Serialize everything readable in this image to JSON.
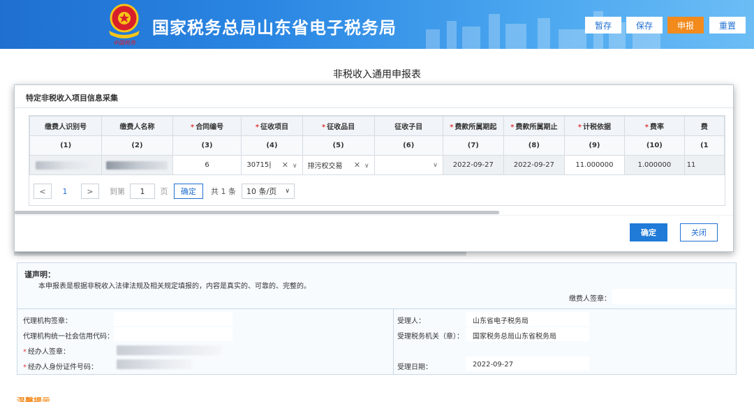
{
  "header": {
    "title": "国家税务总局山东省电子税务局",
    "emblem_caption": "中国税务",
    "buttons": [
      "暂存",
      "保存",
      "申报",
      "重置"
    ],
    "accent_color": "#f28a1c",
    "brand_color": "#1f6fd1"
  },
  "form_title": "非税收入通用申报表",
  "modal": {
    "title": "特定非税收入项目信息采集",
    "columns": [
      {
        "label": "缴费人识别号",
        "required": false,
        "index": "(1)"
      },
      {
        "label": "缴费人名称",
        "required": false,
        "index": "(2)"
      },
      {
        "label": "合同编号",
        "required": true,
        "index": "(3)"
      },
      {
        "label": "征收项目",
        "required": true,
        "index": "(4)"
      },
      {
        "label": "征收品目",
        "required": true,
        "index": "(5)"
      },
      {
        "label": "征收子目",
        "required": false,
        "index": "(6)"
      },
      {
        "label": "费款所属期起",
        "required": true,
        "index": "(7)"
      },
      {
        "label": "费款所属期止",
        "required": true,
        "index": "(8)"
      },
      {
        "label": "计税依据",
        "required": true,
        "index": "(9)"
      },
      {
        "label": "费率",
        "required": true,
        "index": "(10)"
      },
      {
        "label": "费",
        "required": false,
        "index": "(1"
      }
    ],
    "row": {
      "contract_no": "6",
      "levy_item": "30715|",
      "levy_category": "排污权交易",
      "levy_sub": "",
      "period_start": "2022-09-27",
      "period_end": "2022-09-27",
      "tax_basis": "11.000000",
      "rate": "1.000000",
      "fee_partial": "11"
    },
    "pager": {
      "prev": "<",
      "current": "1",
      "next": ">",
      "goto_label": "到第",
      "goto_value": "1",
      "page_unit": "页",
      "confirm": "确定",
      "total": "共 1 条",
      "page_size": "10 条/页"
    },
    "confirm_button": "确定",
    "close_button": "关闭"
  },
  "declaration": {
    "heading": "谨声明：",
    "text": "本申报表是根据非税收入法律法规及相关规定填报的，内容是真实的、可靠的、完整的。",
    "payer_signature_label": "缴费人签章：",
    "agency_seal_label": "代理机构签章：",
    "agency_credit_code_label": "代理机构统一社会信用代码：",
    "handler_signature_label": "经办人签章：",
    "handler_id_label": "经办人身份证件号码：",
    "acceptor_label": "受理人：",
    "acceptor_value": "山东省电子税务局",
    "tax_office_label": "受理税务机关（章）：",
    "tax_office_value": "国家税务总局山东省税务局",
    "accept_date_label": "受理日期：",
    "accept_date_value": "2022-09-27"
  },
  "tip": "温馨提示"
}
